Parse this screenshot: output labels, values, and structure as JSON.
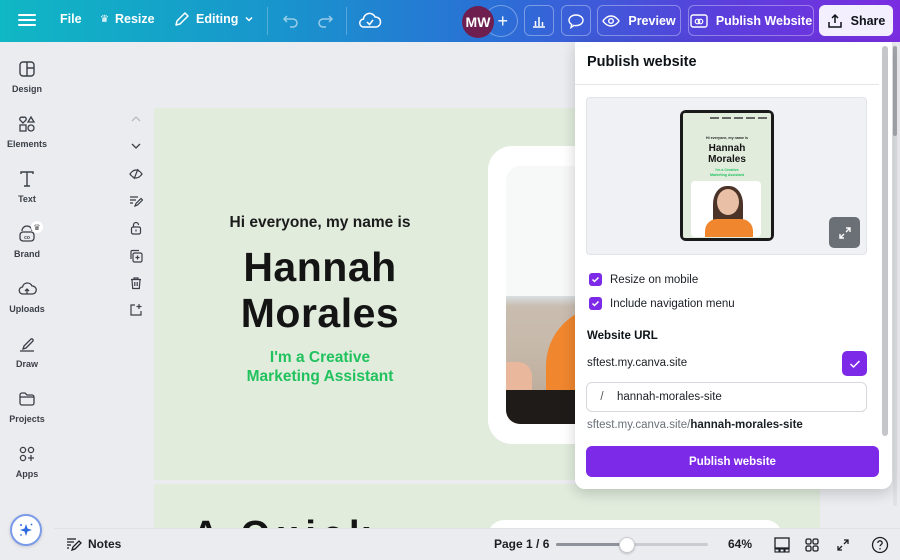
{
  "topbar": {
    "file_label": "File",
    "resize_label": "Resize",
    "editing_label": "Editing",
    "avatar_initials": "MW",
    "preview_label": "Preview",
    "publish_website_label": "Publish Website",
    "share_label": "Share",
    "icons": [
      "menu-icon",
      "crown-icon",
      "pencil-icon",
      "chevron-down-icon",
      "undo-icon",
      "redo-icon",
      "cloud-check-icon",
      "plus-icon",
      "insights-icon",
      "comment-icon",
      "eye-icon",
      "publish-icon",
      "share-icon"
    ]
  },
  "sidebar": {
    "items": [
      {
        "label": "Design",
        "icon": "design-icon"
      },
      {
        "label": "Elements",
        "icon": "elements-icon"
      },
      {
        "label": "Text",
        "icon": "text-icon"
      },
      {
        "label": "Brand",
        "icon": "brand-icon"
      },
      {
        "label": "Uploads",
        "icon": "upload-cloud-icon"
      },
      {
        "label": "Draw",
        "icon": "draw-icon"
      },
      {
        "label": "Projects",
        "icon": "folder-icon"
      },
      {
        "label": "Apps",
        "icon": "apps-icon"
      }
    ]
  },
  "page_tools": [
    "chevron-up-icon",
    "chevron-down-icon",
    "hide-icon",
    "notes-edit-icon",
    "unlock-icon",
    "duplicate-icon",
    "trash-icon",
    "add-page-icon"
  ],
  "canvas": {
    "intro": "Hi everyone, my name is",
    "name_line1": "Hannah",
    "name_line2": "Morales",
    "role_line1": "I'm a Creative",
    "role_line2": "Marketing Assistant",
    "page2_partial_text": "A Quick"
  },
  "bottombar": {
    "notes_label": "Notes",
    "page_indicator": "Page 1 / 6",
    "zoom_percent_label": "64%",
    "zoom_slider_fraction": 0.47
  },
  "publish_panel": {
    "title": "Publish website",
    "preview_intro": "Hi everyone, my name is",
    "preview_name_line1": "Hannah",
    "preview_name_line2": "Morales",
    "preview_role_line1": "I'm a Creative",
    "preview_role_line2": "Marketing Assistant",
    "options": [
      {
        "label": "Resize on mobile",
        "checked": true
      },
      {
        "label": "Include navigation menu",
        "checked": true
      }
    ],
    "website_url_label": "Website URL",
    "domain": "sftest.my.canva.site",
    "slug_prefix": "/",
    "slug_value": "hannah-morales-site",
    "full_url_base": "sftest.my.canva.site/",
    "full_url_path": "hannah-morales-site",
    "publish_button_label": "Publish website"
  },
  "colors": {
    "accent_purple": "#7d2ae8",
    "canvas_green": "#e1ecdd",
    "role_green": "#21c25e"
  }
}
